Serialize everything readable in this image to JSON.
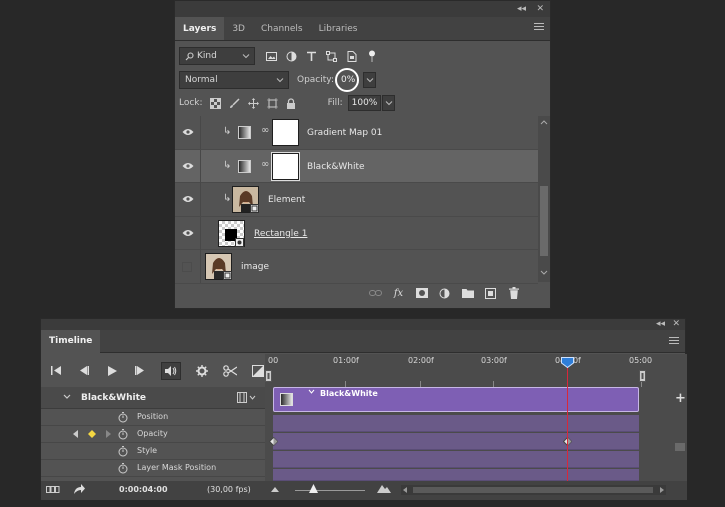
{
  "layers_panel": {
    "tabs": [
      "Layers",
      "3D",
      "Channels",
      "Libraries"
    ],
    "filter": {
      "kind_label": "Kind"
    },
    "blend_mode": "Normal",
    "opacity_label": "Opacity:",
    "opacity_value": "0%",
    "lock_label": "Lock:",
    "fill_label": "Fill:",
    "fill_value": "100%",
    "layers": [
      {
        "name": "Gradient Map 01",
        "visible": true,
        "clipped": true,
        "type": "adjustment"
      },
      {
        "name": "Black&White",
        "visible": true,
        "clipped": true,
        "type": "adjustment",
        "selected": true
      },
      {
        "name": "Element",
        "visible": true,
        "clipped": true,
        "type": "image"
      },
      {
        "name": "Rectangle 1",
        "visible": true,
        "clipped": false,
        "type": "shape"
      },
      {
        "name": "image",
        "visible": false,
        "clipped": false,
        "type": "image"
      }
    ],
    "footer_icons": [
      "link-icon",
      "fx-icon",
      "mask-icon",
      "adjustment-icon",
      "folder-icon",
      "new-layer-icon",
      "trash-icon"
    ]
  },
  "timeline": {
    "tab": "Timeline",
    "ruler_labels": [
      "00",
      "01:00f",
      "02:00f",
      "03:00f",
      "04:00f",
      "05:00"
    ],
    "group": {
      "name": "Black&White",
      "clip_label": "Black&White"
    },
    "properties": [
      "Position",
      "Opacity",
      "Style",
      "Layer Mask Position"
    ],
    "timecode": "0:00:04:00",
    "fps": "(30,00 fps)",
    "playhead_fraction": 0.8
  },
  "colors": {
    "clip": "#7e5fb4",
    "playhead": "#d8283a",
    "keyframe": "#f5d742"
  }
}
